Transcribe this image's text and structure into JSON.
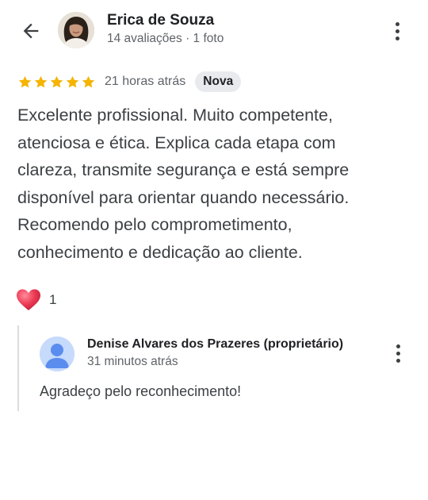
{
  "review": {
    "reviewer_name": "Erica de Souza",
    "reviewer_meta": "14 avaliações · 1 foto",
    "rating": 5,
    "rating_max": 5,
    "time_ago": "21 horas atrás",
    "badge": "Nova",
    "text": "Excelente profissional. Muito competente, atenciosa e ética. Explica cada etapa com clareza, transmite segurança e está sempre disponível para orientar quando necessário. Recomendo pelo comprometimento, conhecimento e dedicação ao cliente.",
    "reaction_count": "1"
  },
  "reply": {
    "owner_name": "Denise Alvares dos Prazeres (proprietário)",
    "time_ago": "31 minutos atrás",
    "text": "Agradeço pelo reconhecimento!"
  },
  "icons": {
    "back": "arrow-back-icon",
    "more": "more-vertical-icon",
    "star": "star-icon",
    "reaction": "heart-icon"
  },
  "colors": {
    "star": "#F4B400",
    "heart": "#E8334A",
    "badge_bg": "#E8EAED",
    "secondary_text": "#5F6368"
  }
}
